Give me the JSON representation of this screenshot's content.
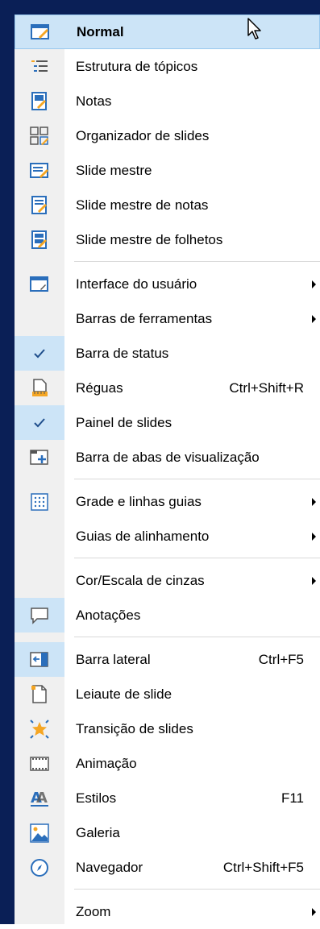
{
  "menu": {
    "items": [
      {
        "label": "Normal",
        "icon": "normal-view-icon",
        "state": "selected"
      },
      {
        "label": "Estrutura de tópicos",
        "icon": "outline-icon"
      },
      {
        "label": "Notas",
        "icon": "notes-icon"
      },
      {
        "label": "Organizador de slides",
        "icon": "slide-sorter-icon"
      },
      {
        "label": "Slide mestre",
        "icon": "master-slide-icon"
      },
      {
        "label": "Slide mestre de notas",
        "icon": "master-notes-icon"
      },
      {
        "label": "Slide mestre de folhetos",
        "icon": "master-handout-icon"
      },
      {
        "label": "Interface do usuário",
        "icon": "user-interface-icon",
        "submenu": true
      },
      {
        "label": "Barras de ferramentas",
        "submenu": true
      },
      {
        "label": "Barra de status",
        "icon": "checkmark-icon",
        "checked": true
      },
      {
        "label": "Réguas",
        "icon": "rulers-icon",
        "shortcut": "Ctrl+Shift+R"
      },
      {
        "label": "Painel de slides",
        "icon": "checkmark-icon",
        "checked": true
      },
      {
        "label": "Barra de abas de visualização",
        "icon": "view-tabs-icon"
      },
      {
        "label": "Grade e linhas guias",
        "icon": "grid-icon",
        "submenu": true
      },
      {
        "label": "Guias de alinhamento",
        "submenu": true
      },
      {
        "label": "Cor/Escala de cinzas",
        "submenu": true
      },
      {
        "label": "Anotações",
        "icon": "comment-icon",
        "checked": true
      },
      {
        "label": "Barra lateral",
        "icon": "sidebar-icon",
        "shortcut": "Ctrl+F5",
        "checked": true
      },
      {
        "label": "Leiaute de slide",
        "icon": "slide-layout-icon"
      },
      {
        "label": "Transição de slides",
        "icon": "slide-transition-icon"
      },
      {
        "label": "Animação",
        "icon": "animation-icon"
      },
      {
        "label": "Estilos",
        "icon": "styles-icon",
        "shortcut": "F11"
      },
      {
        "label": "Galeria",
        "icon": "gallery-icon"
      },
      {
        "label": "Navegador",
        "icon": "navigator-icon",
        "shortcut": "Ctrl+Shift+F5"
      },
      {
        "label": "Zoom",
        "submenu": true
      }
    ]
  },
  "colors": {
    "selection_bg": "#cce4f7",
    "selection_border": "#99c9ef",
    "frame": "#0a1f56",
    "icon_blue": "#2a6ebb",
    "icon_orange": "#f5a623"
  }
}
